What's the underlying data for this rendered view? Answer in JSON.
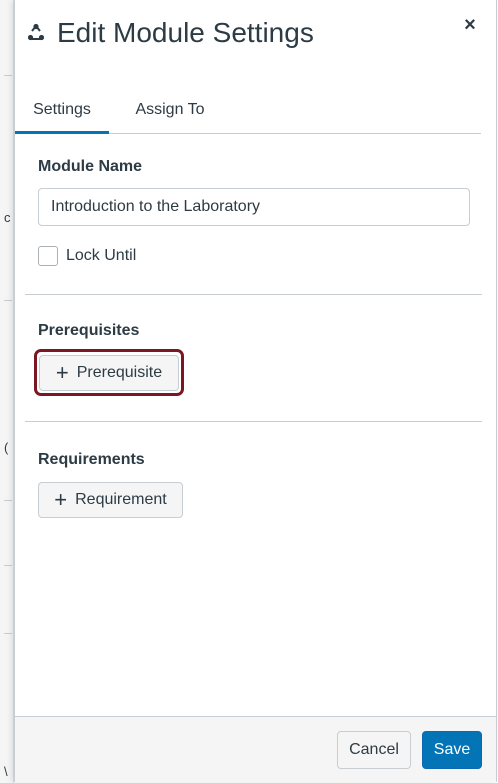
{
  "dialog": {
    "title": "Edit Module Settings",
    "close_label": "×"
  },
  "tabs": [
    {
      "label": "Settings",
      "active": true
    },
    {
      "label": "Assign To",
      "active": false
    }
  ],
  "settings": {
    "module_name_label": "Module Name",
    "module_name_value": "Introduction to the Laboratory",
    "lock_until_label": "Lock Until",
    "lock_until_checked": false,
    "prerequisites_label": "Prerequisites",
    "add_prerequisite_label": "Prerequisite",
    "requirements_label": "Requirements",
    "add_requirement_label": "Requirement"
  },
  "footer": {
    "cancel_label": "Cancel",
    "save_label": "Save"
  },
  "background": {
    "fragments": [
      "c",
      "(",
      "\\"
    ]
  },
  "colors": {
    "accent": "#0374b5",
    "highlight": "#7a1720",
    "text": "#2d3b45",
    "border": "#c7cdd1"
  },
  "icons": {
    "module": "module-icon",
    "close": "close-icon",
    "plus": "plus-icon"
  }
}
